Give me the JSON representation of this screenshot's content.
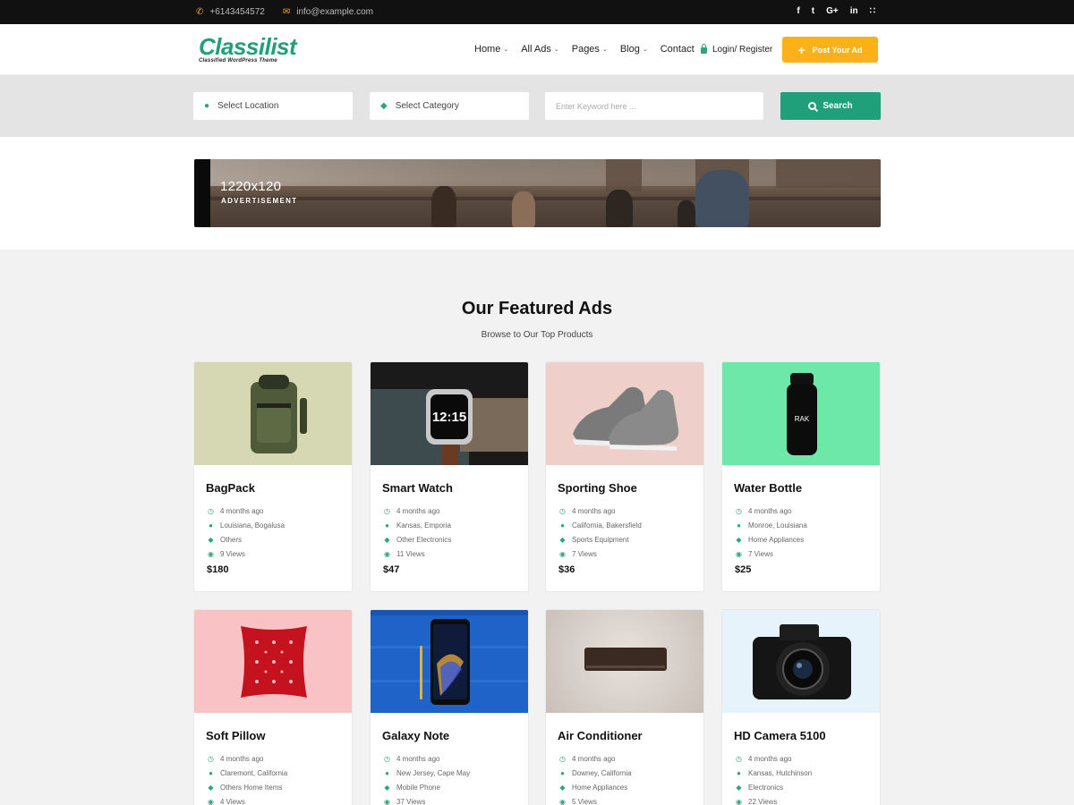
{
  "topbar": {
    "phone": "+6143454572",
    "email": "info@example.com",
    "social": [
      "f",
      "t",
      "G+",
      "in",
      "rss"
    ]
  },
  "header": {
    "logo_name": "Classilist",
    "logo_tagline": "Classified WordPress Theme",
    "nav": [
      {
        "label": "Home",
        "dropdown": true
      },
      {
        "label": "All Ads",
        "dropdown": true
      },
      {
        "label": "Pages",
        "dropdown": true
      },
      {
        "label": "Blog",
        "dropdown": true
      },
      {
        "label": "Contact",
        "dropdown": false
      }
    ],
    "login_label": "Login/ Register",
    "post_ad_label": "Post Your Ad"
  },
  "search": {
    "location_label": "Select Location",
    "category_label": "Select Category",
    "keyword_placeholder": "Enter Keyword here ...",
    "search_label": "Search"
  },
  "banner": {
    "size_text": "1220x120",
    "ad_text": "ADVERTISEMENT"
  },
  "featured": {
    "title": "Our Featured Ads",
    "subtitle": "Browse to Our Top Products",
    "ads": [
      {
        "title": "BagPack",
        "time": "4 months ago",
        "location": "Louisiana, Bogalusa",
        "category": "Others",
        "views": "9 Views",
        "price": "$180"
      },
      {
        "title": "Smart Watch",
        "time": "4 months ago",
        "location": "Kansas, Emporia",
        "category": "Other Electronics",
        "views": "11 Views",
        "price": "$47"
      },
      {
        "title": "Sporting Shoe",
        "time": "4 months ago",
        "location": "California, Bakersfield",
        "category": "Sports Equipment",
        "views": "7 Views",
        "price": "$36"
      },
      {
        "title": "Water Bottle",
        "time": "4 months ago",
        "location": "Monroe, Louisiana",
        "category": "Home Appliances",
        "views": "7 Views",
        "price": "$25"
      },
      {
        "title": "Soft Pillow",
        "time": "4 months ago",
        "location": "Claremont, California",
        "category": "Others Home Items",
        "views": "4 Views",
        "price": ""
      },
      {
        "title": "Galaxy Note",
        "time": "4 months ago",
        "location": "New Jersey, Cape May",
        "category": "Mobile Phone",
        "views": "37 Views",
        "price": ""
      },
      {
        "title": "Air Conditioner",
        "time": "4 months ago",
        "location": "Downey, California",
        "category": "Home Appliances",
        "views": "5 Views",
        "price": ""
      },
      {
        "title": "HD Camera 5100",
        "time": "4 months ago",
        "location": "Kansas, Hutchinson",
        "category": "Electronics",
        "views": "22 Views",
        "price": ""
      }
    ]
  },
  "colors": {
    "brand_green": "#1f9f7a",
    "accent_orange": "#fbb117",
    "topbar_bg": "#111111"
  }
}
